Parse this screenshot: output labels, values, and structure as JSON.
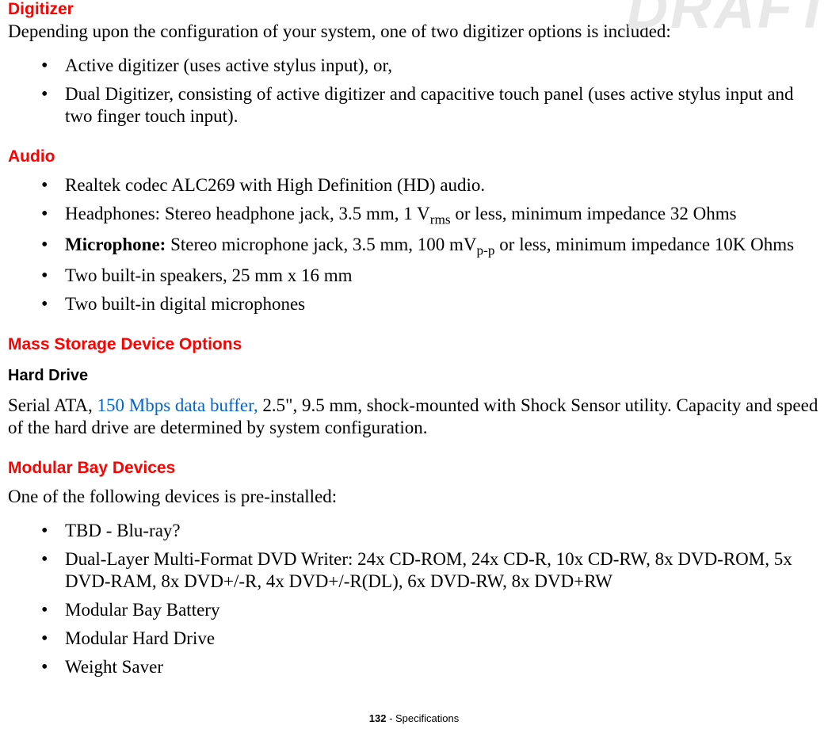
{
  "watermark": "DRAFT",
  "digitizer": {
    "heading": "Digitizer",
    "intro": "Depending upon the configuration of your system, one of two digitizer options is included:",
    "items": [
      "Active digitizer (uses active stylus input), or,",
      "Dual Digitizer, consisting of active digitizer and capacitive touch panel (uses active stylus input and two finger touch input)."
    ]
  },
  "audio": {
    "heading": "Audio",
    "items": {
      "codec": "Realtek codec ALC269 with High Definition (HD) audio.",
      "headphones_pre": "Headphones: Stereo headphone jack, 3.5 mm, 1 V",
      "headphones_sub": "rms",
      "headphones_post": " or less, minimum impedance 32 Ohms",
      "mic_label": "Microphone:",
      "mic_pre": " Stereo microphone jack, 3.5 mm, 100 mV",
      "mic_sub": "p-p",
      "mic_post": " or less, minimum impedance 10K Ohms",
      "speakers": "Two built-in speakers, 25 mm x 16 mm",
      "mics": "Two built-in digital microphones"
    }
  },
  "storage": {
    "heading": "Mass Storage Device Options",
    "hdd_heading": "Hard Drive",
    "hdd_pre": "Serial ATA, ",
    "hdd_blue": "150 Mbps data buffer,",
    "hdd_post": " 2.5\", 9.5 mm, shock-mounted with Shock Sensor utility. Capacity and speed of the hard drive are determined by system configuration."
  },
  "modular": {
    "heading": "Modular Bay Devices",
    "intro": "One of the following devices is pre-installed:",
    "items": [
      "TBD - Blu-ray?",
      "Dual-Layer Multi-Format DVD Writer: 24x CD-ROM, 24x CD-R, 10x CD-RW, 8x DVD-ROM, 5x DVD-RAM, 8x DVD+/-R, 4x DVD+/-R(DL), 6x DVD-RW, 8x DVD+RW",
      "Modular Bay Battery",
      "Modular Hard Drive",
      "Weight Saver"
    ]
  },
  "footer": {
    "page": "132",
    "sep": " - ",
    "label": "Specifications"
  }
}
